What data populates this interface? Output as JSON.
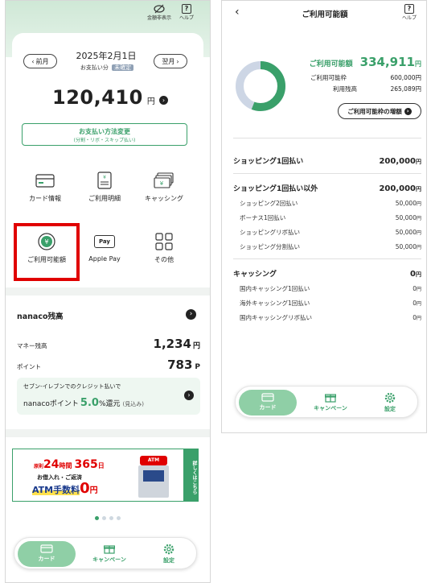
{
  "left": {
    "header": {
      "hide_amount_label": "金額非表示",
      "help_label": "ヘルプ",
      "help_glyph": "?"
    },
    "billing": {
      "date": "2025年2月1日",
      "subtitle": "お支払い分",
      "status_badge": "未確定",
      "prev_label": "前月",
      "next_label": "翌月",
      "amount": "120,410",
      "amount_unit": "円",
      "change_payment_title": "お支払い方法変更",
      "change_payment_sub": "(分割・リボ・スキップ払い)"
    },
    "menu": [
      {
        "label": "カード情報",
        "icon": "card-icon"
      },
      {
        "label": "ご利用明細",
        "icon": "statement-icon"
      },
      {
        "label": "キャッシング",
        "icon": "cash-icon"
      },
      {
        "label": "ご利用可能額",
        "icon": "coin-icon"
      },
      {
        "label": "Apple Pay",
        "icon": "apple-pay-icon",
        "glyph": "Pay"
      },
      {
        "label": "その他",
        "icon": "grid-icon"
      }
    ],
    "nanaco": {
      "title": "nanaco残高",
      "money_label": "マネー残高",
      "money_value": "1,234",
      "money_unit": "円",
      "point_label": "ポイント",
      "point_value": "783",
      "point_unit": "P",
      "promo_line1": "セブン-イレブンでのクレジット払いで",
      "promo_prefix": "nanacoポイント",
      "promo_rate": "5.0",
      "promo_suffix": "%還元",
      "promo_note": "(見込み)"
    },
    "banner": {
      "tag": "原則",
      "hours": "24",
      "hours_unit": "時間",
      "days": "365",
      "days_unit": "日",
      "line2": "お借入れ・ご返済",
      "fee_label": "ATM手数料",
      "fee_value": "0",
      "fee_unit": "円",
      "atm_label": "ATM",
      "side_label": "詳しくはこちら"
    },
    "nav": {
      "card": "カード",
      "campaign": "キャンペーン",
      "settings": "設定"
    }
  },
  "right": {
    "title": "ご利用可能額",
    "help_label": "ヘルプ",
    "help_glyph": "?",
    "available_label": "ご利用可能額",
    "available_value": "334,911",
    "available_unit": "円",
    "limit_label": "ご利用可能枠",
    "limit_value": "600,000円",
    "used_label": "利用残高",
    "used_value": "265,089円",
    "available_fraction": 0.558,
    "increase_button": "ご利用可能枠の増額",
    "shopping_once_label": "ショッピング1回払い",
    "shopping_once_value": "200,000",
    "shopping_other_label": "ショッピング1回払い以外",
    "shopping_other_value": "200,000",
    "shopping_items": [
      {
        "label": "ショッピング2回払い",
        "value": "50,000"
      },
      {
        "label": "ボーナス1回払い",
        "value": "50,000"
      },
      {
        "label": "ショッピングリボ払い",
        "value": "50,000"
      },
      {
        "label": "ショッピング分割払い",
        "value": "50,000"
      }
    ],
    "cashing_label": "キャッシング",
    "cashing_value": "0",
    "cashing_items": [
      {
        "label": "国内キャッシング1回払い",
        "value": "0"
      },
      {
        "label": "海外キャッシング1回払い",
        "value": "0"
      },
      {
        "label": "国内キャッシングリボ払い",
        "value": "0"
      }
    ],
    "unit": "円",
    "nav": {
      "card": "カード",
      "campaign": "キャンペーン",
      "settings": "設定"
    }
  },
  "colors": {
    "accent": "#3aa06a",
    "highlight_border": "#e00000",
    "donut_track": "#cdd6e5",
    "badge": "#8fa0b5"
  }
}
